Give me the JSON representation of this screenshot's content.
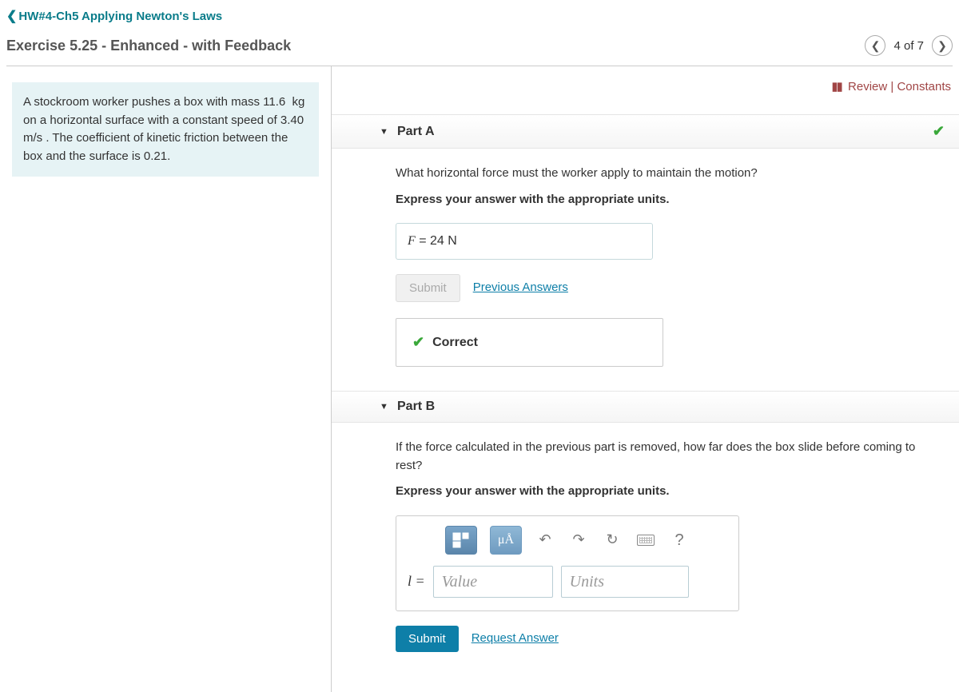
{
  "breadcrumb": "HW#4-Ch5 Applying Newton's Laws",
  "exercise_title": "Exercise 5.25 - Enhanced - with Feedback",
  "nav": {
    "count_text": "4 of 7"
  },
  "review": {
    "review": "Review",
    "sep": " | ",
    "constants": "Constants"
  },
  "problem_text": "A stockroom worker pushes a box with mass 11.6  kg on a horizontal surface with a constant speed of 3.40  m/s . The coefficient of kinetic friction between the box and the surface is 0.21.",
  "partA": {
    "title": "Part A",
    "question": "What horizontal force must the worker apply to maintain the motion?",
    "instruction": "Express your answer with the appropriate units.",
    "answer_var": "F",
    "answer_eq": " = ",
    "answer_val": "24 N",
    "submit": "Submit",
    "prev": "Previous Answers",
    "feedback": "Correct"
  },
  "partB": {
    "title": "Part B",
    "question": "If the force calculated in the previous part is removed, how far does the box slide before coming to rest?",
    "instruction": "Express your answer with the appropriate units.",
    "var_label": "l = ",
    "value_placeholder": "Value",
    "units_placeholder": "Units",
    "units_btn": "μÅ",
    "help": "?",
    "submit": "Submit",
    "request": "Request Answer"
  }
}
